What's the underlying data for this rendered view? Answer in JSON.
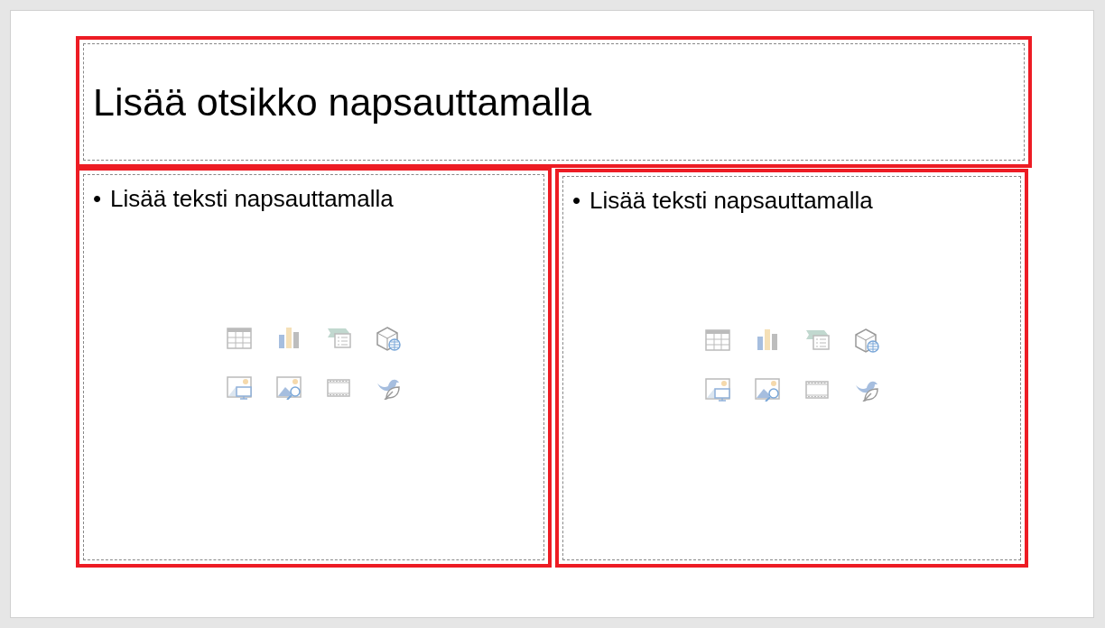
{
  "title_placeholder": {
    "text": "Lisää otsikko napsauttamalla"
  },
  "content_placeholders": [
    {
      "bullet": "•",
      "text": "Lisää teksti napsauttamalla"
    },
    {
      "bullet": "•",
      "text": "Lisää teksti napsauttamalla"
    }
  ]
}
